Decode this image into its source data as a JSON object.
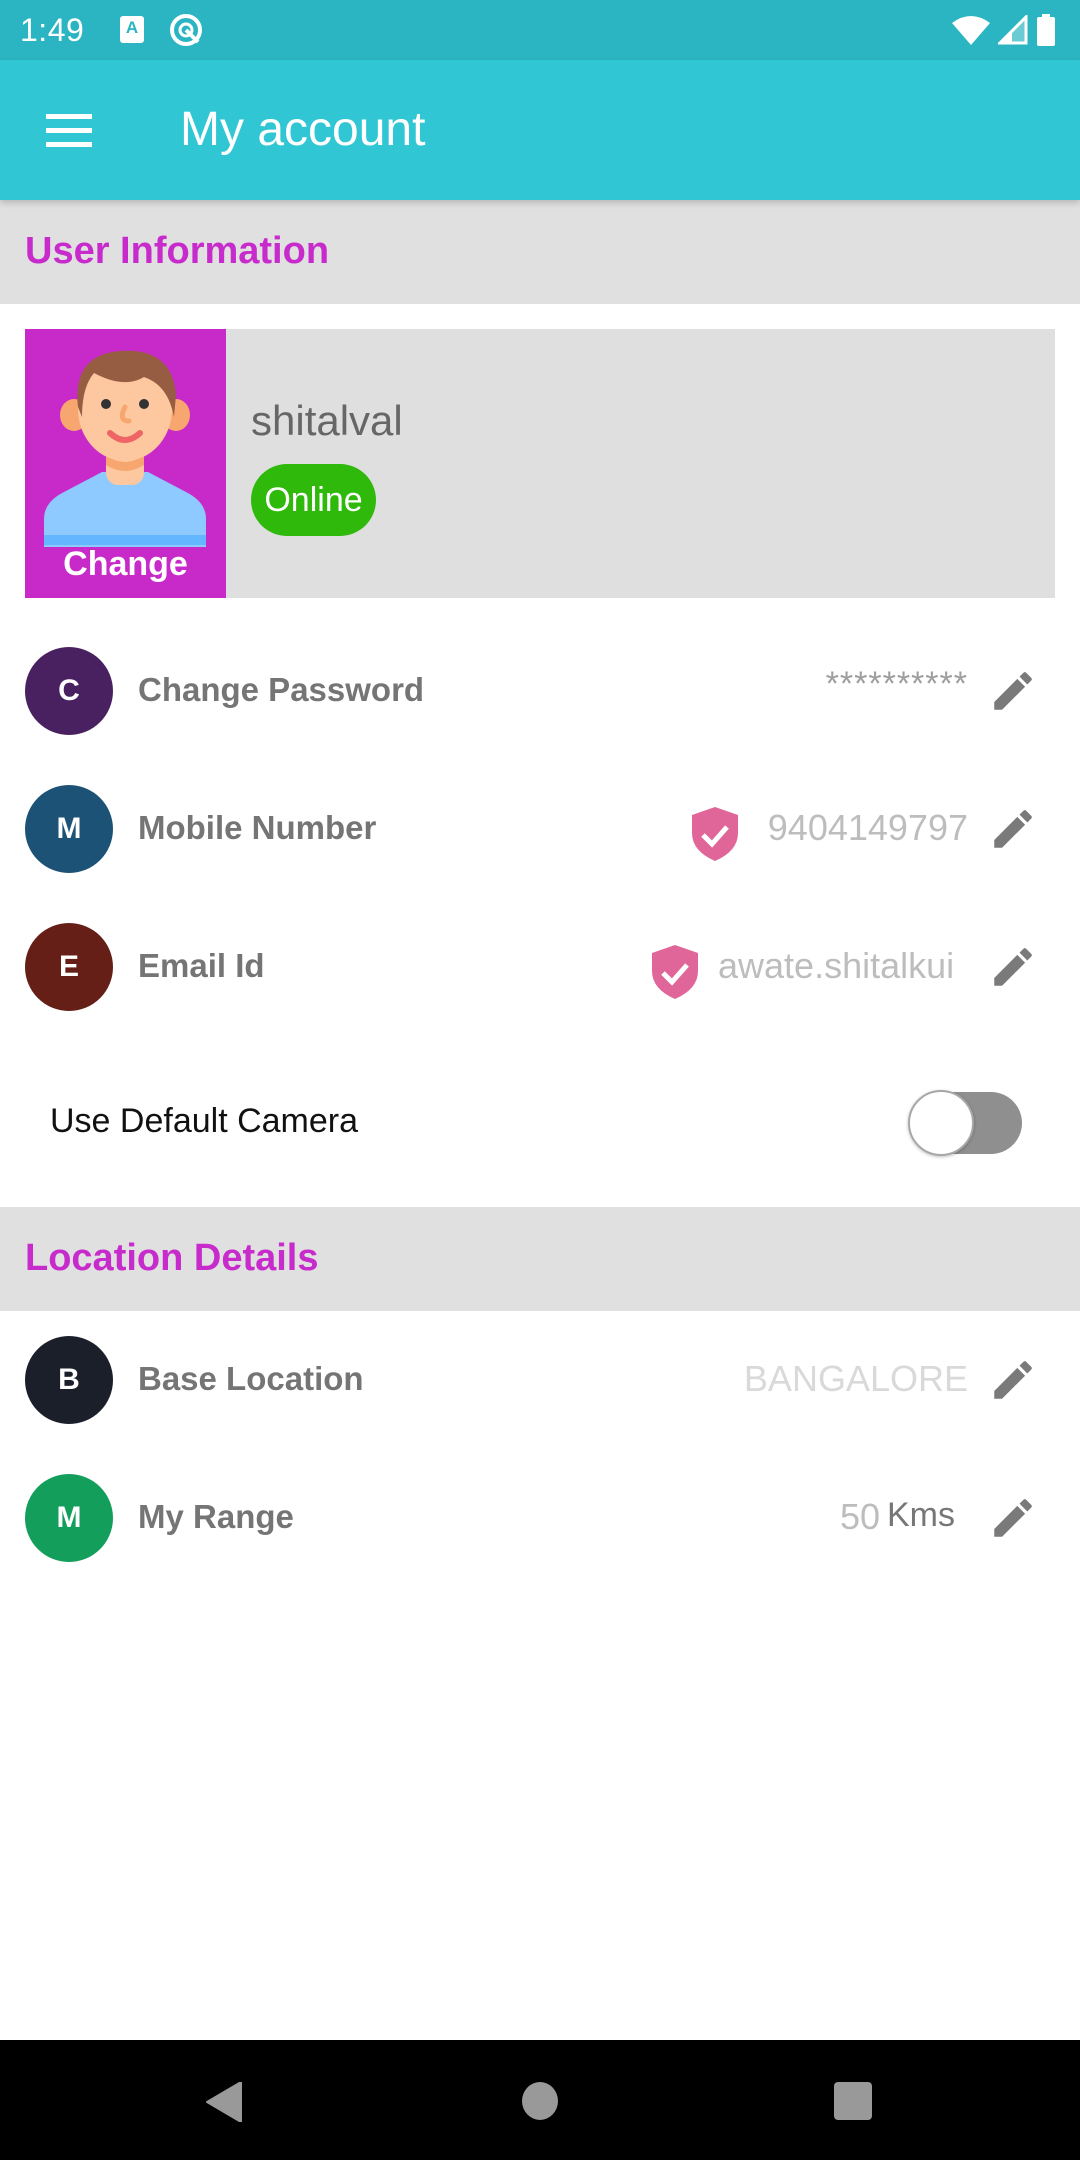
{
  "status_bar": {
    "time": "1:49",
    "left_icons": [
      "accessibility-a-icon",
      "q-logo-icon"
    ],
    "right_icons": [
      "wifi-icon",
      "cell-signal-icon",
      "battery-icon"
    ]
  },
  "app_bar": {
    "menu_icon": "hamburger-menu-icon",
    "title": "My account"
  },
  "colors": {
    "status_bar": "#2bb5c3",
    "app_bar": "#31c6d4",
    "section_title": "#c72bcc",
    "avatar_bg": "#c829c9",
    "online": "#2fb90b",
    "verified_shield": "#e0669a"
  },
  "user_information": {
    "section_title": "User Information",
    "profile": {
      "avatar_action": "Change",
      "username": "shitalval",
      "status": "Online"
    },
    "rows": [
      {
        "initial": "C",
        "label": "Change Password",
        "value": "**********",
        "verified": false,
        "color": "#4a2160",
        "action_icon": "pencil-edit-icon"
      },
      {
        "initial": "M",
        "label": "Mobile Number",
        "value": "9404149797",
        "verified": true,
        "color": "#1c5275",
        "action_icon": "pencil-edit-icon"
      },
      {
        "initial": "E",
        "label": "Email Id",
        "value": "awate.shitalkui",
        "verified": true,
        "color": "#651f17",
        "action_icon": "pencil-edit-icon"
      }
    ],
    "camera_toggle": {
      "label": "Use Default Camera",
      "enabled": false
    }
  },
  "location_details": {
    "section_title": "Location Details",
    "rows": [
      {
        "initial": "B",
        "label": "Base Location",
        "value": "BANGALORE",
        "color": "#1b1f2a",
        "action_icon": "pencil-edit-icon"
      },
      {
        "initial": "M",
        "label": "My Range",
        "value": "50",
        "unit": "Kms",
        "color": "#139f5b",
        "action_icon": "pencil-edit-icon"
      }
    ]
  },
  "nav_bar": {
    "buttons": [
      "back",
      "home",
      "recents"
    ]
  }
}
